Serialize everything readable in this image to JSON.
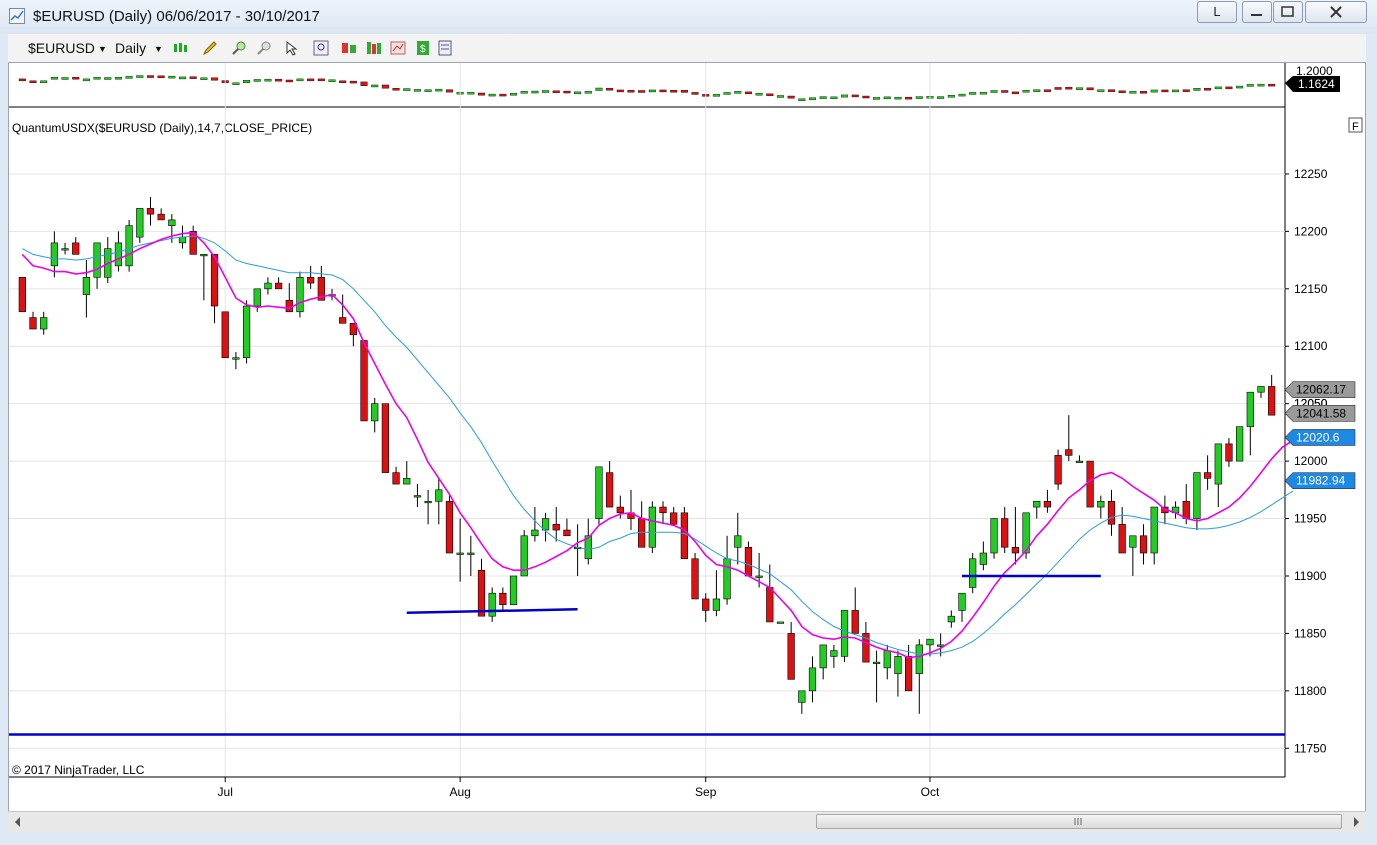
{
  "window": {
    "title": "$EURUSD (Daily)  06/06/2017 - 30/10/2017",
    "btn_l": "L"
  },
  "toolbar": {
    "instrument": "$EURUSD",
    "interval": "Daily"
  },
  "price_panel": {
    "top_label": "1.2000",
    "last_price": "1.1624",
    "colors": {
      "up": "#22cc22",
      "down": "#dd1111"
    }
  },
  "indicator": {
    "label": "QuantumUSDX($EURUSD  (Daily),14,7,CLOSE_PRICE)",
    "f_button": "F",
    "copyright": "© 2017 NinjaTrader, LLC",
    "badges": [
      "12062.17",
      "12041.58",
      "12020.6",
      "11982.94"
    ],
    "badge_overlap_text": "12050"
  },
  "colors": {
    "fast_ma": "#ee00ee",
    "slow_ma": "#2a9de0",
    "support_lines": "#0000cc",
    "badge_blue": "#1e88e5",
    "badge_gray": "#9a9a9a"
  },
  "chart_data": {
    "type": "candlestick",
    "title": "QuantumUSDX($EURUSD  (Daily),14,7,CLOSE_PRICE)",
    "x_tick_labels": [
      "Jul",
      "Aug",
      "Sep",
      "Oct"
    ],
    "y_tick_labels": [
      "12250",
      "12200",
      "12150",
      "12100",
      "12050",
      "12000",
      "11950",
      "11900",
      "11850",
      "11800",
      "11750"
    ],
    "ylim": [
      11725,
      12290
    ],
    "ohlc": [
      [
        12160,
        12160,
        12130,
        12130
      ],
      [
        12125,
        12130,
        12115,
        12115
      ],
      [
        12115,
        12130,
        12110,
        12125
      ],
      [
        12170,
        12200,
        12160,
        12190
      ],
      [
        12185,
        12190,
        12180,
        12185
      ],
      [
        12190,
        12195,
        12180,
        12180
      ],
      [
        12145,
        12175,
        12125,
        12160
      ],
      [
        12160,
        12190,
        12150,
        12190
      ],
      [
        12160,
        12195,
        12155,
        12185
      ],
      [
        12170,
        12200,
        12165,
        12190
      ],
      [
        12170,
        12210,
        12165,
        12205
      ],
      [
        12195,
        12220,
        12190,
        12220
      ],
      [
        12220,
        12230,
        12205,
        12215
      ],
      [
        12215,
        12220,
        12210,
        12210
      ],
      [
        12205,
        12215,
        12190,
        12210
      ],
      [
        12190,
        12205,
        12185,
        12195
      ],
      [
        12200,
        12205,
        12180,
        12180
      ],
      [
        12180,
        12180,
        12140,
        12180
      ],
      [
        12180,
        12180,
        12120,
        12135
      ],
      [
        12130,
        12130,
        12090,
        12090
      ],
      [
        12090,
        12095,
        12080,
        12090
      ],
      [
        12090,
        12140,
        12085,
        12135
      ],
      [
        12135,
        12150,
        12130,
        12150
      ],
      [
        12150,
        12160,
        12145,
        12155
      ],
      [
        12155,
        12160,
        12150,
        12150
      ],
      [
        12140,
        12155,
        12130,
        12130
      ],
      [
        12130,
        12165,
        12125,
        12160
      ],
      [
        12160,
        12170,
        12150,
        12155
      ],
      [
        12160,
        12170,
        12140,
        12140
      ],
      [
        12145,
        12150,
        12140,
        12145
      ],
      [
        12125,
        12145,
        12120,
        12120
      ],
      [
        12120,
        12120,
        12100,
        12110
      ],
      [
        12105,
        12105,
        12040,
        12035
      ],
      [
        12035,
        12055,
        12025,
        12050
      ],
      [
        12050,
        12050,
        11990,
        11990
      ],
      [
        11990,
        11995,
        11980,
        11980
      ],
      [
        11980,
        12000,
        11980,
        11985
      ],
      [
        11970,
        11980,
        11960,
        11970
      ],
      [
        11965,
        11975,
        11945,
        11965
      ],
      [
        11965,
        11985,
        11945,
        11975
      ],
      [
        11965,
        11970,
        11920,
        11920
      ],
      [
        11920,
        11950,
        11895,
        11920
      ],
      [
        11920,
        11935,
        11900,
        11920
      ],
      [
        11905,
        11915,
        11865,
        11865
      ],
      [
        11865,
        11890,
        11860,
        11885
      ],
      [
        11885,
        11890,
        11870,
        11875
      ],
      [
        11875,
        11900,
        11875,
        11900
      ],
      [
        11900,
        11940,
        11900,
        11935
      ],
      [
        11935,
        11960,
        11930,
        11940
      ],
      [
        11940,
        11955,
        11930,
        11950
      ],
      [
        11945,
        11960,
        11930,
        11940
      ],
      [
        11940,
        11950,
        11935,
        11935
      ],
      [
        11925,
        11945,
        11900,
        11925
      ],
      [
        11915,
        11950,
        11910,
        11935
      ],
      [
        11950,
        11990,
        11945,
        11995
      ],
      [
        11990,
        12000,
        11975,
        11960
      ],
      [
        11960,
        11970,
        11950,
        11955
      ],
      [
        11955,
        11975,
        11940,
        11950
      ],
      [
        11950,
        11965,
        11930,
        11925
      ],
      [
        11925,
        11965,
        11920,
        11960
      ],
      [
        11960,
        11965,
        11945,
        11955
      ],
      [
        11955,
        11960,
        11945,
        11945
      ],
      [
        11955,
        11960,
        11925,
        11915
      ],
      [
        11915,
        11920,
        11895,
        11880
      ],
      [
        11880,
        11885,
        11860,
        11870
      ],
      [
        11870,
        11905,
        11865,
        11880
      ],
      [
        11880,
        11935,
        11875,
        11915
      ],
      [
        11925,
        11955,
        11910,
        11935
      ],
      [
        11925,
        11930,
        11910,
        11900
      ],
      [
        11900,
        11920,
        11890,
        11900
      ],
      [
        11890,
        11910,
        11880,
        11860
      ],
      [
        11860,
        11860,
        11860,
        11860
      ],
      [
        11850,
        11860,
        11810,
        11810
      ],
      [
        11790,
        11800,
        11780,
        11800
      ],
      [
        11800,
        11830,
        11790,
        11820
      ],
      [
        11820,
        11840,
        11810,
        11840
      ],
      [
        11830,
        11840,
        11820,
        11835
      ],
      [
        11830,
        11850,
        11825,
        11870
      ],
      [
        11870,
        11890,
        11860,
        11850
      ],
      [
        11850,
        11860,
        11830,
        11825
      ],
      [
        11825,
        11835,
        11790,
        11825
      ],
      [
        11820,
        11840,
        11810,
        11835
      ],
      [
        11815,
        11835,
        11795,
        11830
      ],
      [
        11830,
        11840,
        11800,
        11800
      ],
      [
        11815,
        11845,
        11780,
        11840
      ],
      [
        11840,
        11845,
        11830,
        11845
      ],
      [
        11840,
        11850,
        11830,
        11840
      ],
      [
        11860,
        11870,
        11855,
        11865
      ],
      [
        11870,
        11880,
        11860,
        11885
      ],
      [
        11890,
        11920,
        11885,
        11915
      ],
      [
        11910,
        11930,
        11905,
        11920
      ],
      [
        11920,
        11950,
        11915,
        11950
      ],
      [
        11950,
        11960,
        11920,
        11925
      ],
      [
        11925,
        11960,
        11910,
        11920
      ],
      [
        11920,
        11940,
        11915,
        11955
      ],
      [
        11960,
        11965,
        11950,
        11965
      ],
      [
        11965,
        11975,
        11955,
        11960
      ],
      [
        12005,
        12010,
        11975,
        11980
      ],
      [
        12010,
        12040,
        12000,
        12005
      ],
      [
        12000,
        12005,
        12000,
        12000
      ],
      [
        12000,
        12000,
        11975,
        11960
      ],
      [
        11960,
        11970,
        11950,
        11965
      ],
      [
        11965,
        11975,
        11935,
        11945
      ],
      [
        11945,
        11960,
        11920,
        11920
      ],
      [
        11925,
        11930,
        11900,
        11935
      ],
      [
        11935,
        11945,
        11910,
        11920
      ],
      [
        11920,
        11930,
        11910,
        11960
      ],
      [
        11960,
        11970,
        11945,
        11955
      ],
      [
        11955,
        11965,
        11950,
        11960
      ],
      [
        11965,
        11980,
        11945,
        11950
      ],
      [
        11950,
        11975,
        11940,
        11990
      ],
      [
        11990,
        12005,
        11975,
        11985
      ],
      [
        11980,
        12000,
        11960,
        12015
      ],
      [
        12015,
        12020,
        11995,
        12000
      ],
      [
        12000,
        12005,
        12000,
        12030
      ],
      [
        12030,
        12050,
        12005,
        12060
      ],
      [
        12060,
        12060,
        12055,
        12065
      ],
      [
        12065,
        12075,
        12040,
        12040
      ]
    ],
    "fast_ma": [
      12180,
      12170,
      12168,
      12165,
      12165,
      12163,
      12164,
      12167,
      12172,
      12176,
      12180,
      12185,
      12189,
      12193,
      12196,
      12198,
      12199,
      12190,
      12178,
      12160,
      12142,
      12136,
      12134,
      12135,
      12134,
      12133,
      12138,
      12141,
      12143,
      12145,
      12136,
      12124,
      12103,
      12085,
      12067,
      12050,
      12038,
      12019,
      11999,
      11985,
      11971,
      11955,
      11942,
      11928,
      11915,
      11908,
      11905,
      11905,
      11908,
      11912,
      11917,
      11922,
      11929,
      11933,
      11944,
      11950,
      11954,
      11955,
      11950,
      11948,
      11946,
      11944,
      11940,
      11930,
      11918,
      11910,
      11908,
      11905,
      11900,
      11895,
      11890,
      11880,
      11870,
      11856,
      11849,
      11846,
      11845,
      11847,
      11846,
      11842,
      11838,
      11835,
      11833,
      11829,
      11830,
      11833,
      11837,
      11843,
      11852,
      11864,
      11877,
      11891,
      11903,
      11912,
      11922,
      11935,
      11945,
      11957,
      11968,
      11975,
      11983,
      11988,
      11990,
      11985,
      11978,
      11972,
      11966,
      11958,
      11955,
      11950,
      11948,
      11950,
      11955,
      11960,
      11968,
      11978,
      11990,
      12002,
      12012,
      12018
    ],
    "slow_ma": [
      12185,
      12180,
      12178,
      12176,
      12176,
      12175,
      12176,
      12178,
      12180,
      12182,
      12185,
      12188,
      12190,
      12192,
      12194,
      12195,
      12196,
      12194,
      12190,
      12183,
      12175,
      12172,
      12170,
      12168,
      12166,
      12164,
      12164,
      12164,
      12163,
      12162,
      12158,
      12150,
      12140,
      12130,
      12118,
      12108,
      12099,
      12088,
      12077,
      12066,
      12055,
      12042,
      12030,
      12016,
      12000,
      11985,
      11970,
      11958,
      11948,
      11939,
      11932,
      11928,
      11925,
      11923,
      11925,
      11930,
      11933,
      11937,
      11938,
      11938,
      11938,
      11938,
      11937,
      11932,
      11926,
      11920,
      11915,
      11913,
      11910,
      11906,
      11902,
      11895,
      11888,
      11878,
      11869,
      11862,
      11856,
      11852,
      11849,
      11846,
      11842,
      11839,
      11836,
      11834,
      11832,
      11832,
      11833,
      11835,
      11838,
      11843,
      11850,
      11858,
      11867,
      11875,
      11884,
      11893,
      11902,
      11912,
      11922,
      11932,
      11940,
      11946,
      11951,
      11953,
      11952,
      11950,
      11948,
      11946,
      11944,
      11942,
      11941,
      11941,
      11942,
      11944,
      11947,
      11951,
      11956,
      11962,
      11968,
      11974
    ],
    "support_lines": [
      {
        "from_bar": 36,
        "from_y": 11868,
        "to_bar": 52,
        "to_y": 11871
      },
      {
        "from_bar": 88,
        "from_y": 11900,
        "to_bar": 101,
        "to_y": 11900
      },
      {
        "from_bar": -1,
        "from_y": 11762,
        "to_bar": 126,
        "to_y": 11762
      }
    ]
  }
}
